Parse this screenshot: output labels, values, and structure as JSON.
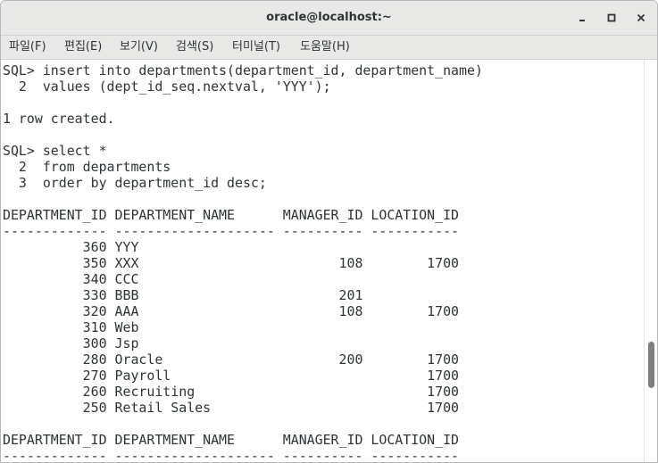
{
  "window": {
    "title": "oracle@localhost:~"
  },
  "menu": [
    "파일(F)",
    "편집(E)",
    "보기(V)",
    "검색(S)",
    "터미널(T)",
    "도움말(H)"
  ],
  "terminal": {
    "lines": [
      "SQL> insert into departments(department_id, department_name)",
      "  2  values (dept_id_seq.nextval, 'YYY');",
      "",
      "1 row created.",
      "",
      "SQL> select *",
      "  2  from departments",
      "  3  order by department_id desc;",
      "",
      "DEPARTMENT_ID DEPARTMENT_NAME      MANAGER_ID LOCATION_ID",
      "------------- -------------------- ---------- -----------",
      "          360 YYY",
      "          350 XXX                         108        1700",
      "          340 CCC",
      "          330 BBB                         201",
      "          320 AAA                         108        1700",
      "          310 Web",
      "          300 Jsp",
      "          280 Oracle                      200        1700",
      "          270 Payroll                                1700",
      "          260 Recruiting                             1700",
      "          250 Retail Sales                           1700",
      "",
      "DEPARTMENT_ID DEPARTMENT_NAME      MANAGER_ID LOCATION_ID",
      "------------- -------------------- ---------- -----------"
    ]
  },
  "colors": {
    "titlebar_bg": "#e8e8e7",
    "terminal_bg": "#ffffff",
    "terminal_fg": "#2e3436",
    "scroll_thumb": "#7d7f7c"
  },
  "icons": {
    "minimize": "minimize-icon",
    "maximize": "maximize-icon",
    "close": "close-icon"
  }
}
